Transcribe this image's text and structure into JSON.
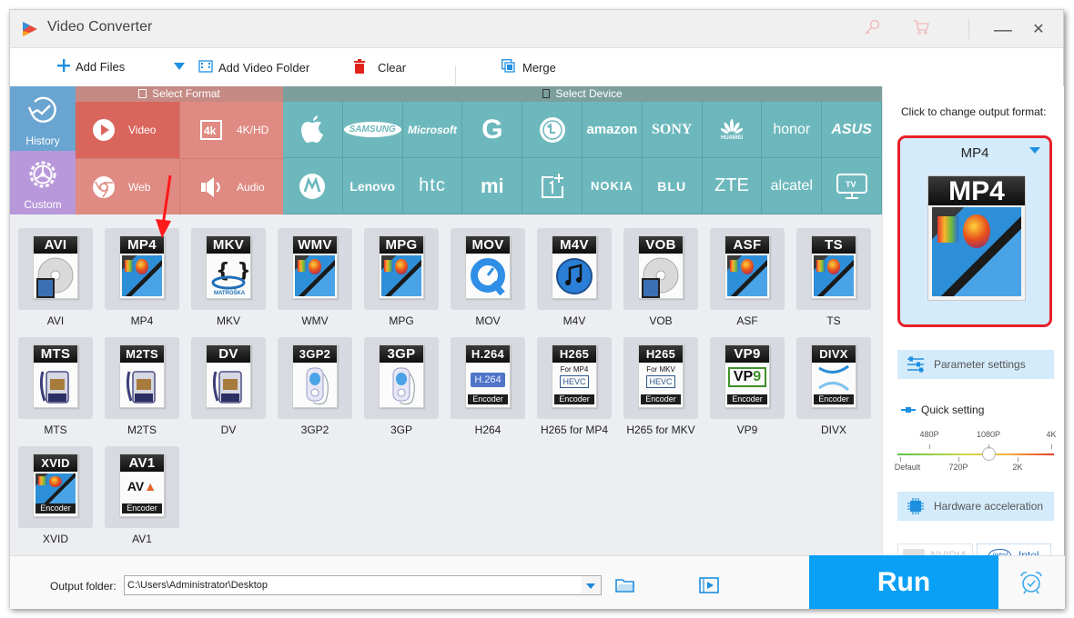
{
  "app": {
    "title": "Video Converter"
  },
  "titlebar": {
    "register_icon": "key-icon",
    "buy_icon": "cart-icon",
    "minimize": "—",
    "close": "✕"
  },
  "toolbar": {
    "add_files": "Add Files",
    "add_video_folder": "Add Video Folder",
    "clear": "Clear",
    "merge": "Merge"
  },
  "sidebar": {
    "history": "History",
    "custom": "Custom"
  },
  "select_format": {
    "header": "Select Format",
    "categories": [
      {
        "label": "Video",
        "icon": "play-icon",
        "active": true
      },
      {
        "label": "4K/HD",
        "icon": "4k-icon",
        "active": false
      },
      {
        "label": "Web",
        "icon": "chrome-icon",
        "active": false
      },
      {
        "label": "Audio",
        "icon": "speaker-icon",
        "active": false
      }
    ]
  },
  "select_device": {
    "header": "Select Device",
    "devices": [
      "Apple",
      "SAMSUNG",
      "Microsoft",
      "G",
      "LG",
      "amazon",
      "SONY",
      "HUAWEI",
      "honor",
      "ASUS",
      "Motorola",
      "Lenovo",
      "htc",
      "mi",
      "OnePlus",
      "NOKIA",
      "BLU",
      "ZTE",
      "alcatel",
      "TV"
    ]
  },
  "formats": [
    {
      "name": "AVI",
      "badge": "AVI",
      "art": "disc-film"
    },
    {
      "name": "MP4",
      "badge": "MP4",
      "art": "film"
    },
    {
      "name": "MKV",
      "badge": "MKV",
      "art": "matroska"
    },
    {
      "name": "WMV",
      "badge": "WMV",
      "art": "film"
    },
    {
      "name": "MPG",
      "badge": "MPG",
      "art": "film"
    },
    {
      "name": "MOV",
      "badge": "MOV",
      "art": "quicktime"
    },
    {
      "name": "M4V",
      "badge": "M4V",
      "art": "itunes"
    },
    {
      "name": "VOB",
      "badge": "VOB",
      "art": "disc-film"
    },
    {
      "name": "ASF",
      "badge": "ASF",
      "art": "film"
    },
    {
      "name": "TS",
      "badge": "TS",
      "art": "film"
    },
    {
      "name": "MTS",
      "badge": "MTS",
      "art": "camcorder"
    },
    {
      "name": "M2TS",
      "badge": "M2TS",
      "art": "camcorder"
    },
    {
      "name": "DV",
      "badge": "DV",
      "art": "camcorder"
    },
    {
      "name": "3GP2",
      "badge": "3GP2",
      "art": "phone"
    },
    {
      "name": "3GP",
      "badge": "3GP",
      "art": "phone"
    },
    {
      "name": "H264",
      "badge": "H.264",
      "art": "h264",
      "sub": "H.264",
      "encoder": "Encoder"
    },
    {
      "name": "H265 for MP4",
      "badge": "H265",
      "art": "hevc",
      "sub": "For MP4",
      "codec": "HEVC",
      "encoder": "Encoder"
    },
    {
      "name": "H265 for MKV",
      "badge": "H265",
      "art": "hevc",
      "sub": "For MKV",
      "codec": "HEVC",
      "encoder": "Encoder"
    },
    {
      "name": "VP9",
      "badge": "VP9",
      "art": "vp9",
      "sub": "VP9",
      "encoder": "Encoder"
    },
    {
      "name": "DIVX",
      "badge": "DIVX",
      "art": "divx",
      "encoder": "Encoder"
    },
    {
      "name": "XVID",
      "badge": "XVID",
      "art": "film",
      "encoder": "Encoder"
    },
    {
      "name": "AV1",
      "badge": "AV1",
      "art": "av1",
      "sub": "AV1",
      "encoder": "Encoder"
    }
  ],
  "right_panel": {
    "hint": "Click to change output format:",
    "output_format": "MP4",
    "parameter_settings": "Parameter settings",
    "quick_setting": "Quick setting",
    "quality_ticks_top": [
      "480P",
      "1080P",
      "4K"
    ],
    "quality_ticks_bottom": [
      "Default",
      "720P",
      "2K"
    ],
    "quality_value": "1080P",
    "quality_fraction": 0.5,
    "hardware_acceleration": "Hardware acceleration",
    "nvidia": "NVIDIA",
    "intel": "Intel",
    "highlight_color": "#e8202a"
  },
  "bottom": {
    "output_folder_label": "Output folder:",
    "output_folder_value": "C:\\Users\\Administrator\\Desktop",
    "run": "Run"
  },
  "colors": {
    "accent": "#0aa0f5",
    "format_active": "#d9655c",
    "format_bg": "#df8a82",
    "device_bg": "#6db8bd",
    "history": "#6aa4d1",
    "custom": "#b898db"
  }
}
